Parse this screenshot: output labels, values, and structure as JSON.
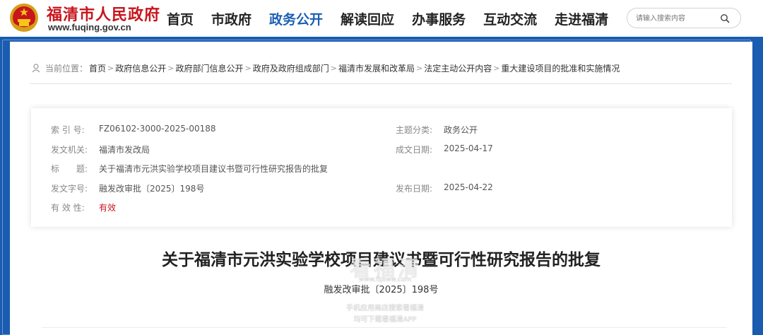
{
  "header": {
    "site_name": "福清市人民政府",
    "site_url": "www.fuqing.gov.cn",
    "nav": [
      {
        "label": "首页"
      },
      {
        "label": "市政府"
      },
      {
        "label": "政务公开",
        "active": true
      },
      {
        "label": "解读回应"
      },
      {
        "label": "办事服务"
      },
      {
        "label": "互动交流"
      },
      {
        "label": "走进福清"
      }
    ],
    "search": {
      "placeholder": "请输入搜索内容",
      "icon": "search-icon"
    }
  },
  "colors": {
    "brand_red": "#c8161d",
    "brand_blue": "#1a5cb0",
    "active_nav": "#1a5fb4"
  },
  "breadcrumb": {
    "prefix": "当前位置：",
    "items": [
      "首页",
      "政府信息公开",
      "政府部门信息公开",
      "政府及政府组成部门",
      "福清市发展和改革局",
      "法定主动公开内容",
      "重大建设项目的批准和实施情况"
    ]
  },
  "info": {
    "index_label": "索 引 号:",
    "index_value": "FZ06102-3000-2025-00188",
    "topic_label": "主题分类:",
    "topic_value": "政务公开",
    "issuer_label": "发文机关:",
    "issuer_value": "福清市发改局",
    "date_label": "成文日期:",
    "date_value": "2025-04-17",
    "title_label": "标　　题:",
    "title_value": "关于福清市元洪实验学校项目建议书暨可行性研究报告的批复",
    "docno_label": "发文字号:",
    "docno_value": "融发改审批〔2025〕198号",
    "publish_label": "发布日期:",
    "publish_value": "2025-04-22",
    "valid_label": "有 效 性:",
    "valid_value": "有效"
  },
  "document": {
    "title": "关于福清市元洪实验学校项目建议书暨可行性研究报告的批复",
    "number": "融发改审批〔2025〕198号"
  },
  "watermark": {
    "logo": "看福清",
    "site": "www.fqxww.com",
    "line1": "手机应用商店搜索看福清",
    "line2": "均可下载看福清APP"
  }
}
